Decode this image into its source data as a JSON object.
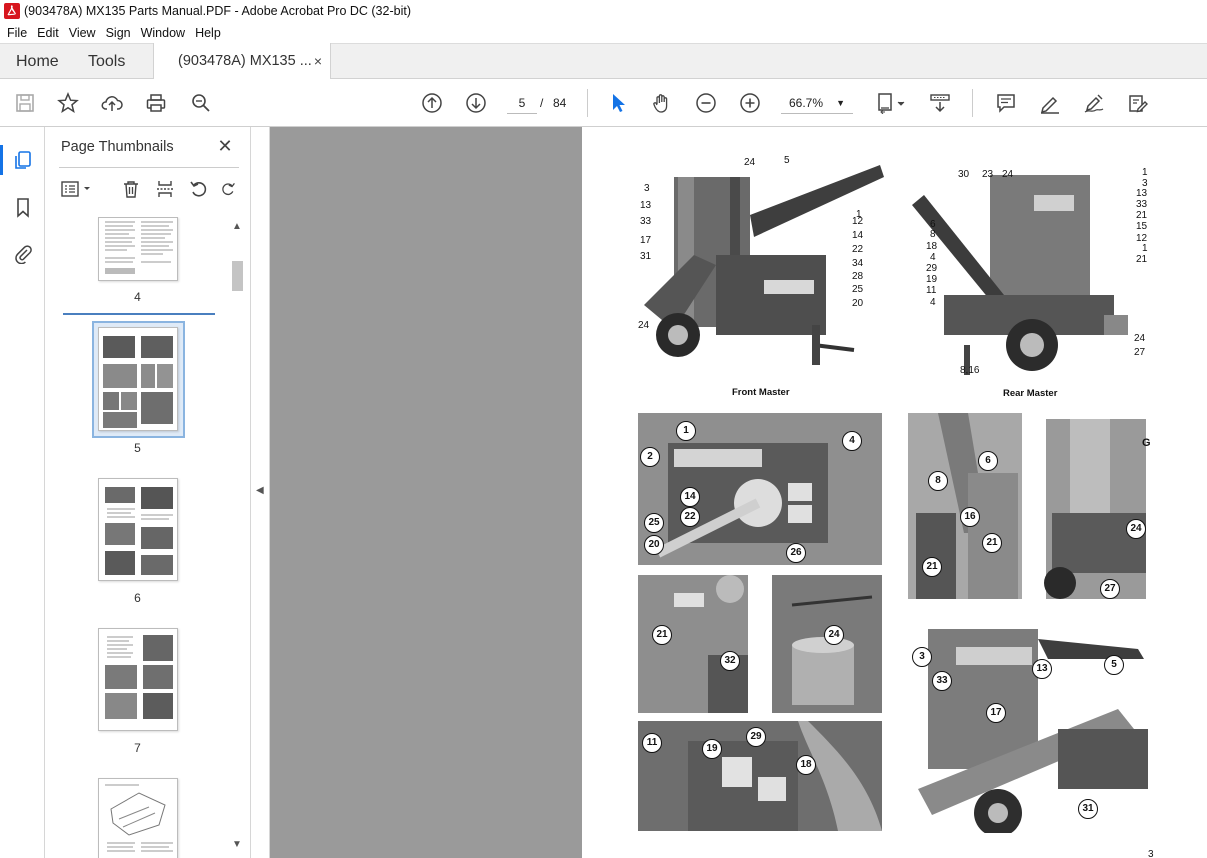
{
  "window": {
    "title": "(903478A) MX135 Parts Manual.PDF - Adobe Acrobat Pro DC (32-bit)"
  },
  "menu": [
    "File",
    "Edit",
    "View",
    "Sign",
    "Window",
    "Help"
  ],
  "tabs": {
    "home": "Home",
    "tools": "Tools",
    "document": "(903478A) MX135 ...",
    "close": "×"
  },
  "toolbar": {
    "current_page": "5",
    "page_separator": "/",
    "total_pages": "84",
    "zoom": "66.7%"
  },
  "panel": {
    "title": "Page Thumbnails",
    "close": "✕"
  },
  "thumbnails": [
    {
      "label": "4"
    },
    {
      "label": "5"
    },
    {
      "label": "6"
    },
    {
      "label": "7"
    }
  ],
  "document": {
    "captions": {
      "front": "Front Master",
      "rear": "Rear Master"
    },
    "page_number": "3",
    "front_callouts": [
      "24",
      "5",
      "3",
      "13",
      "33",
      "17",
      "31",
      "24",
      "1",
      "12",
      "14",
      "22",
      "34",
      "28",
      "25",
      "20"
    ],
    "rear_callouts": [
      "30",
      "23",
      "24",
      "1",
      "3",
      "13",
      "33",
      "21",
      "15",
      "12",
      "1",
      "21",
      "6",
      "8",
      "18",
      "4",
      "29",
      "19",
      "11",
      "4",
      "24",
      "27",
      "8,16"
    ],
    "circles_a": [
      "1",
      "4",
      "2",
      "14",
      "22",
      "25",
      "20",
      "26"
    ],
    "circles_b": [
      "6",
      "8",
      "16",
      "21",
      "21"
    ],
    "circles_c": [
      "24",
      "27"
    ],
    "circles_d": [
      "21",
      "32"
    ],
    "circles_e": [
      "24"
    ],
    "circles_f": [
      "11",
      "19",
      "29",
      "18"
    ],
    "circles_g": [
      "3",
      "13",
      "5",
      "33",
      "17",
      "31"
    ]
  },
  "colors": {
    "accent": "#1473e6",
    "panel_bg": "#9a9a9a",
    "acrobat_red": "#d7161e"
  }
}
